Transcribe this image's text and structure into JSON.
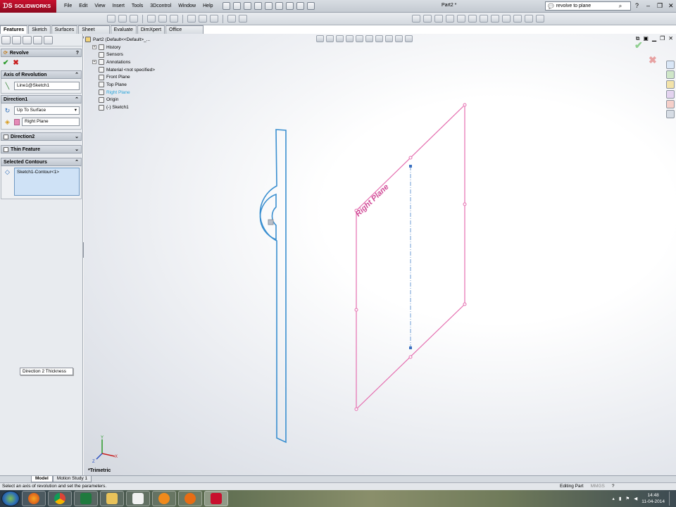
{
  "app": {
    "logo_text": "SOLIDWORKS",
    "document_title": "Part2 *"
  },
  "menu": [
    "File",
    "Edit",
    "View",
    "Insert",
    "Tools",
    "3Dcontrol",
    "Window",
    "Help"
  ],
  "search": {
    "value": "revolve to plane"
  },
  "tabs": [
    "Features",
    "Sketch",
    "Surfaces",
    "Sheet Metal",
    "Evaluate",
    "DimXpert",
    "Office Products"
  ],
  "property_manager": {
    "title": "Revolve",
    "sections": {
      "axis": {
        "header": "Axis of Revolution",
        "value": "Line1@Sketch1"
      },
      "direction1": {
        "header": "Direction1",
        "end_condition": "Up To Surface",
        "reference": "Right Plane"
      },
      "direction2": {
        "header": "Direction2"
      },
      "thin": {
        "header": "Thin Feature"
      },
      "contours": {
        "header": "Selected Contours",
        "value": "Sketch1-Contour<1>"
      }
    },
    "tooltip": "Direction 2 Thickness"
  },
  "tree": {
    "root": "Part2  (Default<<Default>_...",
    "items": [
      {
        "label": "History",
        "expandable": true
      },
      {
        "label": "Sensors",
        "expandable": false
      },
      {
        "label": "Annotations",
        "expandable": true
      },
      {
        "label": "Material <not specified>",
        "expandable": false
      },
      {
        "label": "Front Plane",
        "expandable": false
      },
      {
        "label": "Top Plane",
        "expandable": false
      },
      {
        "label": "Right Plane",
        "expandable": false,
        "highlighted": true
      },
      {
        "label": "Origin",
        "expandable": false
      },
      {
        "label": "(-) Sketch1",
        "expandable": false
      }
    ]
  },
  "viewport": {
    "plane_label": "Right Plane",
    "view_orientation": "*Trimetric",
    "triad": {
      "x": "X",
      "y": "Y",
      "z": "Z"
    }
  },
  "bottom_tabs": [
    "Model",
    "Motion Study 1"
  ],
  "status": {
    "message": "Select an axis of revolution and set the parameters.",
    "mode": "Editing Part",
    "units": "MMGS"
  },
  "clock": {
    "time": "14:48",
    "date": "11-04-2014"
  },
  "colors": {
    "sketch_blue": "#3a8fd0",
    "plane_pink": "#e56fb0",
    "brand_red": "#c8102e",
    "highlight_cyan": "#2aa4d8"
  }
}
